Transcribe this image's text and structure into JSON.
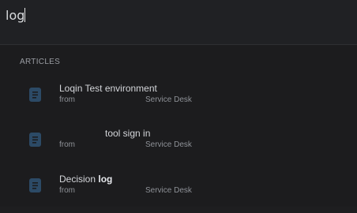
{
  "search": {
    "query": "log"
  },
  "sections": {
    "articles_label": "ARTICLES"
  },
  "results": [
    {
      "title_prefix": "",
      "title_bold": "",
      "title_plain": "Loqin Test environment",
      "from_label": "from",
      "project": "Service Desk",
      "icon": "article-icon"
    },
    {
      "title_prefix": "",
      "title_bold": "",
      "title_plain": "tool sign in",
      "from_label": "from",
      "project": "Service Desk",
      "icon": "article-icon"
    },
    {
      "title_prefix": "Decision ",
      "title_bold": "log",
      "title_plain": "",
      "from_label": "from",
      "project": "Service Desk",
      "icon": "article-icon"
    }
  ],
  "colors": {
    "background": "#1c1c1e",
    "icon": "#2c4a66"
  }
}
